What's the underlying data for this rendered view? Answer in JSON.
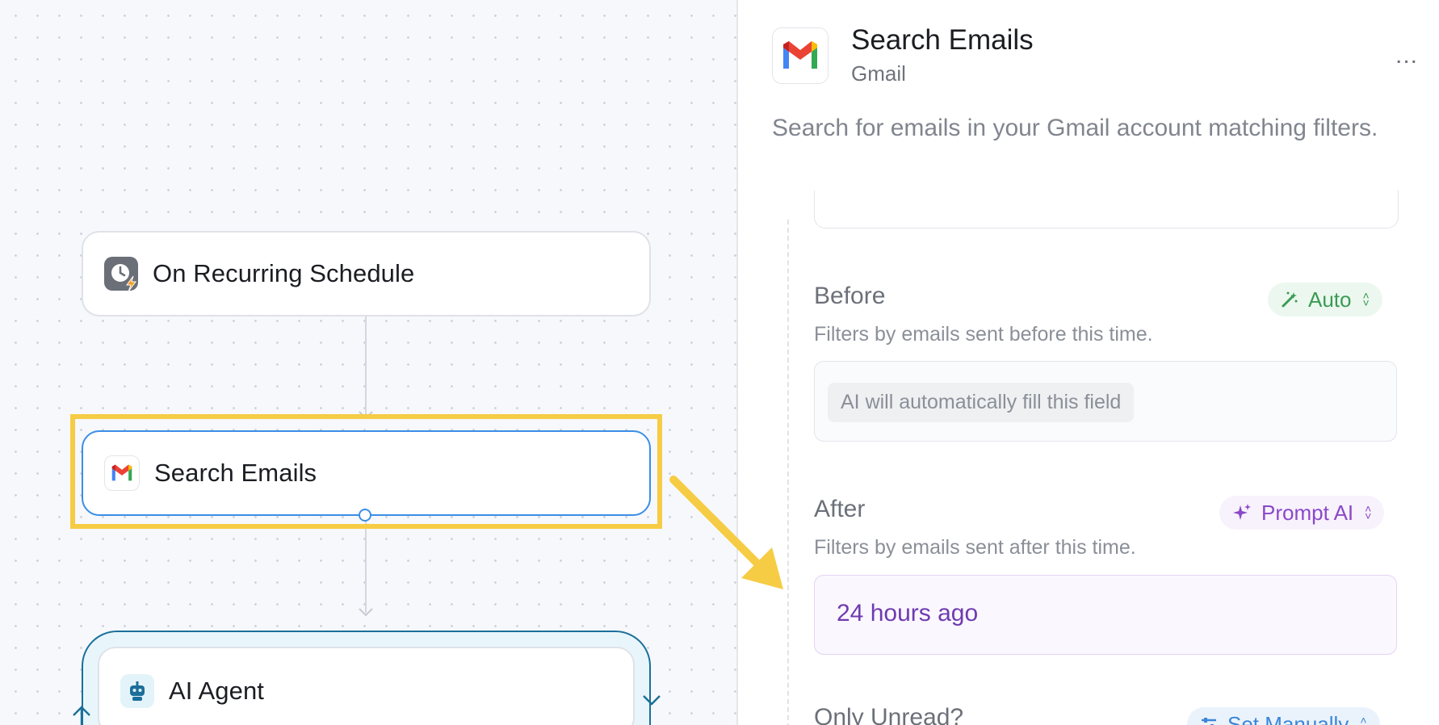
{
  "canvas": {
    "nodes": [
      {
        "id": "schedule",
        "label": "On Recurring Schedule",
        "icon": "clock-bolt-icon"
      },
      {
        "id": "search",
        "label": "Search Emails",
        "icon": "gmail-icon",
        "selected": true
      },
      {
        "id": "agent",
        "label": "AI Agent",
        "icon": "robot-icon"
      }
    ]
  },
  "panel": {
    "title": "Search Emails",
    "app": "Gmail",
    "more": "...",
    "description": "Search for emails in your Gmail account matching filters.",
    "fields": {
      "before": {
        "label": "Before",
        "help": "Filters by emails sent before this time.",
        "mode": "Auto",
        "placeholder_chip": "AI will automatically fill this field"
      },
      "after": {
        "label": "After",
        "help": "Filters by emails sent after this time.",
        "mode": "Prompt AI",
        "value": "24 hours ago"
      },
      "only_unread": {
        "label": "Only Unread?",
        "mode": "Set Manually"
      }
    }
  },
  "colors": {
    "highlight": "#f6cc45",
    "selected_border": "#3b8ee6",
    "auto_green": "#3a9b53",
    "prompt_purple": "#8b48c9",
    "manual_blue": "#3b86d8"
  }
}
